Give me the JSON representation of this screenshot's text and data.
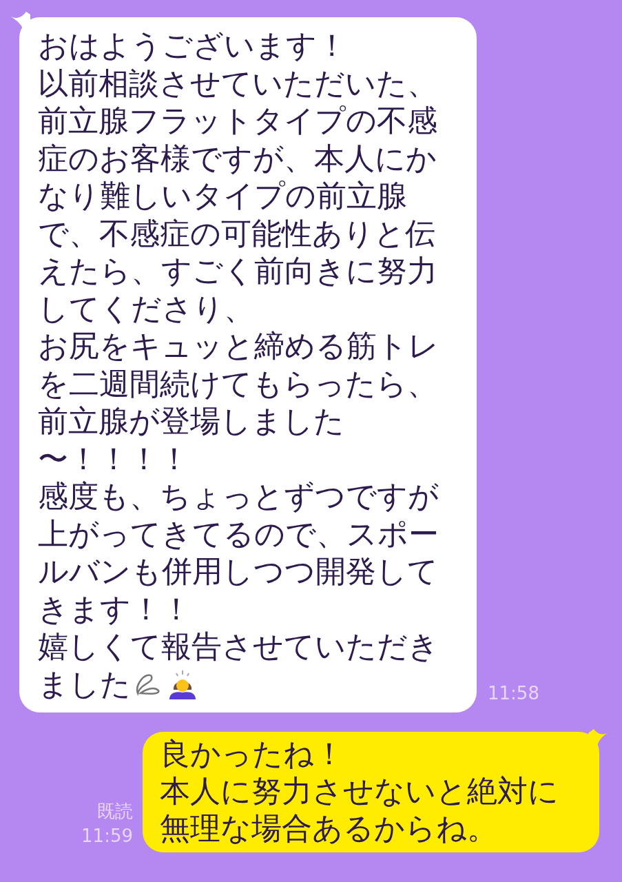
{
  "messages": [
    {
      "kind": "received",
      "lines": [
        "おはようございます！",
        "以前相談させていただいた、",
        "前立腺フラットタイプの不感",
        "症のお客様ですが、本人にか",
        "なり難しいタイプの前立腺",
        "で、不感症の可能性ありと伝",
        "えたら、すごく前向きに努力",
        "してくださり、",
        "お尻をキュッと締める筋トレ",
        "を二週間続けてもらったら、",
        "前立腺が登場しました",
        "〜！！！！",
        "感度も、ちょっとずつですが",
        "上がってきてるので、スポー",
        "ルバンも併用しつつ開発して",
        "きます！！",
        "嬉しくて報告させていただき",
        "ました"
      ],
      "trailing_emoji": true,
      "time": "11:58"
    },
    {
      "kind": "sent",
      "lines": [
        "良かったね！",
        "本人に努力させないと絶対に",
        "無理な場合あるからね。"
      ],
      "read_label": "既読",
      "time": "11:59"
    }
  ]
}
